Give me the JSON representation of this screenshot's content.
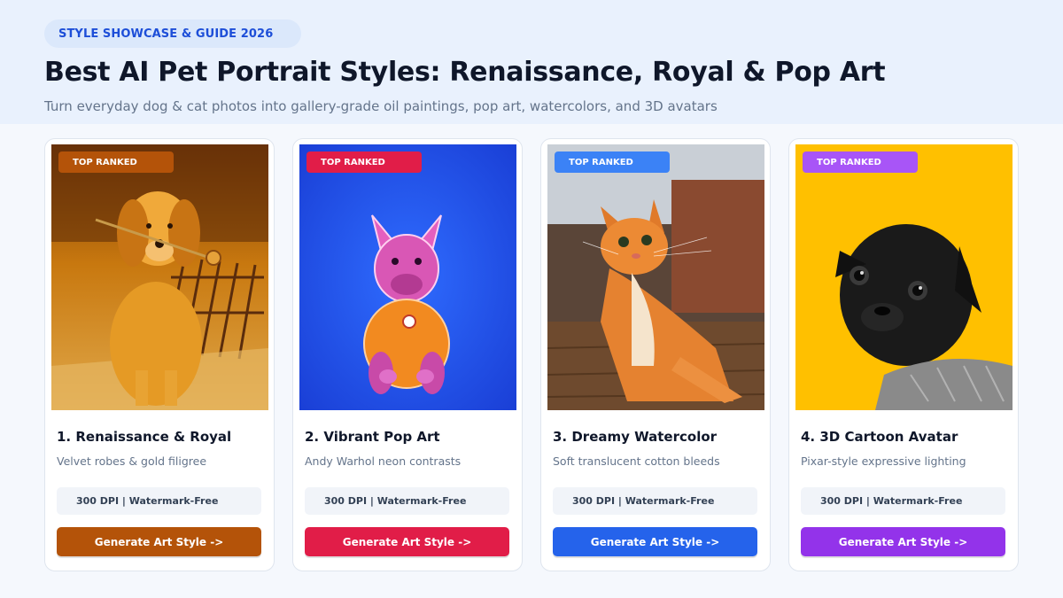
{
  "header": {
    "eyebrow": "STYLE SHOWCASE & GUIDE 2026",
    "title": "Best AI Pet Portrait Styles: Renaissance, Royal & Pop Art",
    "subtitle": "Turn everyday dog & cat photos into gallery-grade oil paintings, pop art, watercolors, and 3D avatars"
  },
  "cards": [
    {
      "badge": "TOP RANKED",
      "title": "1. Renaissance & Royal",
      "description": "Velvet robes & gold filigree",
      "specs": "300 DPI  |  Watermark-Free",
      "cta": "Generate Art Style ->",
      "accent": "#b45309",
      "image": "golden-retriever-with-rose"
    },
    {
      "badge": "TOP RANKED",
      "title": "2. Vibrant Pop Art",
      "description": "Andy Warhol neon contrasts",
      "specs": "300 DPI  |  Watermark-Free",
      "cta": "Generate Art Style ->",
      "accent": "#e11d48",
      "image": "pop-art-french-bulldog"
    },
    {
      "badge": "TOP RANKED",
      "title": "3. Dreamy Watercolor",
      "description": "Soft translucent cotton bleeds",
      "specs": "300 DPI  |  Watermark-Free",
      "cta": "Generate Art Style ->",
      "accent": "#2563eb",
      "image": "orange-tabby-cat"
    },
    {
      "badge": "TOP RANKED",
      "title": "4. 3D Cartoon Avatar",
      "description": "Pixar-style expressive lighting",
      "specs": "300 DPI  |  Watermark-Free",
      "cta": "Generate Art Style ->",
      "accent": "#9333ea",
      "image": "black-pug-in-sweater"
    }
  ]
}
